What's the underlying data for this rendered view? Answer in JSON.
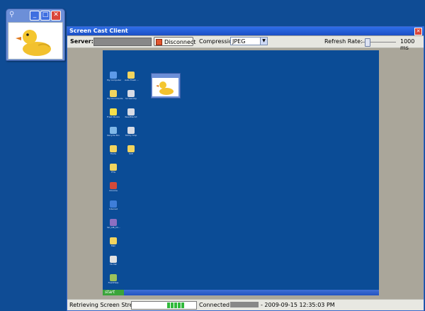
{
  "client": {
    "title": "Screen Cast Client",
    "server_label": "Server:",
    "disconnect_label": "Disconnect",
    "compression_label": "Compression:",
    "compression_value": "JPEG",
    "refresh_label": "Refresh Rate:",
    "refresh_value": "1000 ms"
  },
  "remote_desktop": {
    "start_label": "start",
    "icons": [
      {
        "label": "My Computer",
        "color": "#5d9ae8"
      },
      {
        "label": "Auto Fresh ...",
        "color": "#f2d45e"
      },
      {
        "label": "My Documents",
        "color": "#f2d45e"
      },
      {
        "label": "ScreenClip",
        "color": "#d7dbe5"
      },
      {
        "label": "Fresh Books",
        "color": "#f7e04a"
      },
      {
        "label": "ReadMe.txt",
        "color": "#d7dbe5"
      },
      {
        "label": "Recycle Bin",
        "color": "#7fb8e8"
      },
      {
        "label": "Sticky Snip",
        "color": "#d7dbe5"
      },
      {
        "label": "Fonts",
        "color": "#f2d45e"
      },
      {
        "label": "SCE",
        "color": "#f2d45e"
      },
      {
        "label": "FTG",
        "color": "#f2d45e"
      },
      {
        "label": "Chrome",
        "color": "#d44a3a"
      },
      {
        "label": "Internet",
        "color": "#3e7ed9"
      },
      {
        "label": "Ski_LIB_Cli...",
        "color": "#8e6fc1"
      },
      {
        "label": "Mail",
        "color": "#f2d45e"
      },
      {
        "label": "Hi-Hat",
        "color": "#e2e2e2"
      },
      {
        "label": "FlashHelp",
        "color": "#9cc25b"
      },
      {
        "label": "Photoshop",
        "color": "#7a9ab8"
      }
    ]
  },
  "status": {
    "retrieving": "Retrieving Screen Stream:",
    "progress_blocks": 5,
    "connected": "Connected to",
    "timestamp": "- 2009-09-15 12:35:03 PM"
  }
}
